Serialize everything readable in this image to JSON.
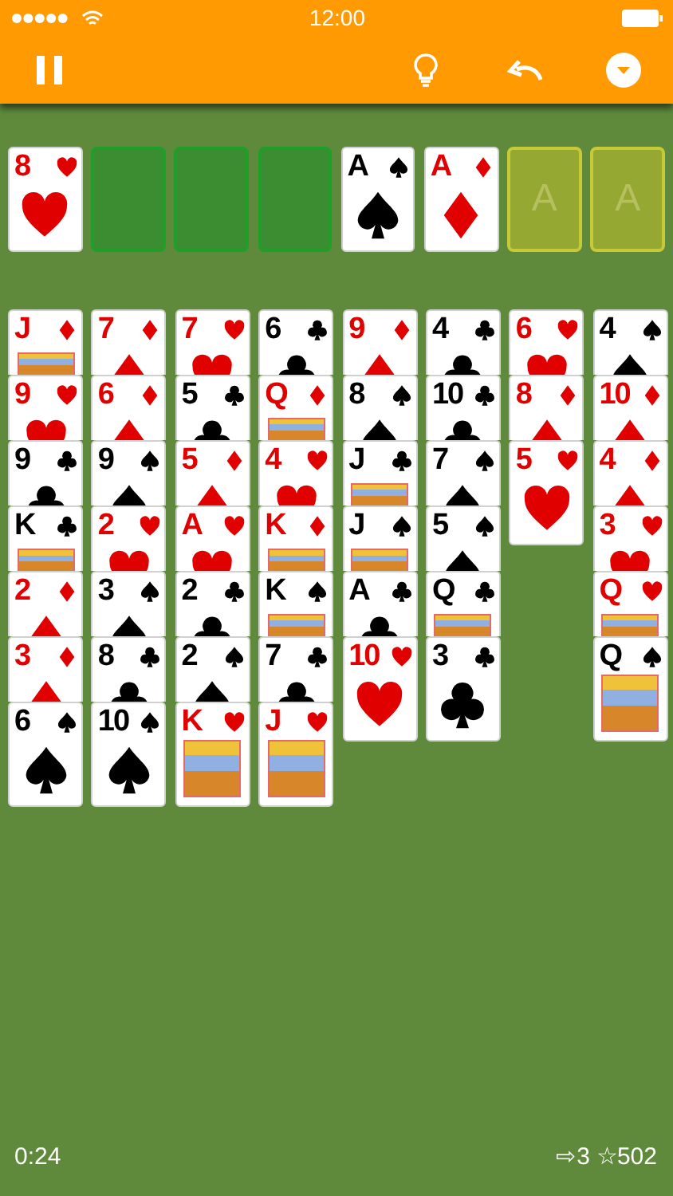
{
  "status_bar": {
    "time": "12:00"
  },
  "free_cells": [
    {
      "rank": "8",
      "kind": "heart",
      "court": false
    },
    {
      "kind": "empty"
    },
    {
      "kind": "empty"
    },
    {
      "kind": "empty"
    }
  ],
  "foundations": [
    {
      "rank": "A",
      "kind": "spade",
      "court": false
    },
    {
      "rank": "A",
      "kind": "diamond",
      "court": false
    },
    {
      "kind": "empty",
      "placeholder": "A"
    },
    {
      "kind": "empty",
      "placeholder": "A"
    }
  ],
  "tableau": [
    [
      {
        "rank": "J",
        "kind": "diamond",
        "court": true
      },
      {
        "rank": "9",
        "kind": "heart",
        "court": false
      },
      {
        "rank": "9",
        "kind": "club",
        "court": false
      },
      {
        "rank": "K",
        "kind": "club",
        "court": true
      },
      {
        "rank": "2",
        "kind": "diamond",
        "court": false
      },
      {
        "rank": "3",
        "kind": "diamond",
        "court": false
      },
      {
        "rank": "6",
        "kind": "spade",
        "court": false
      }
    ],
    [
      {
        "rank": "7",
        "kind": "diamond",
        "court": false
      },
      {
        "rank": "6",
        "kind": "diamond",
        "court": false
      },
      {
        "rank": "9",
        "kind": "spade",
        "court": false
      },
      {
        "rank": "2",
        "kind": "heart",
        "court": false
      },
      {
        "rank": "3",
        "kind": "spade",
        "court": false
      },
      {
        "rank": "8",
        "kind": "club",
        "court": false
      },
      {
        "rank": "10",
        "kind": "spade",
        "court": false
      }
    ],
    [
      {
        "rank": "7",
        "kind": "heart",
        "court": false
      },
      {
        "rank": "5",
        "kind": "club",
        "court": false
      },
      {
        "rank": "5",
        "kind": "diamond",
        "court": false
      },
      {
        "rank": "A",
        "kind": "heart",
        "court": false
      },
      {
        "rank": "2",
        "kind": "club",
        "court": false
      },
      {
        "rank": "2",
        "kind": "spade",
        "court": false
      },
      {
        "rank": "K",
        "kind": "heart",
        "court": true
      }
    ],
    [
      {
        "rank": "6",
        "kind": "club",
        "court": false
      },
      {
        "rank": "Q",
        "kind": "diamond",
        "court": true
      },
      {
        "rank": "4",
        "kind": "heart",
        "court": false
      },
      {
        "rank": "K",
        "kind": "diamond",
        "court": true
      },
      {
        "rank": "K",
        "kind": "spade",
        "court": true
      },
      {
        "rank": "7",
        "kind": "club",
        "court": false
      },
      {
        "rank": "J",
        "kind": "heart",
        "court": true
      }
    ],
    [
      {
        "rank": "9",
        "kind": "diamond",
        "court": false
      },
      {
        "rank": "8",
        "kind": "spade",
        "court": false
      },
      {
        "rank": "J",
        "kind": "club",
        "court": true
      },
      {
        "rank": "J",
        "kind": "spade",
        "court": true
      },
      {
        "rank": "A",
        "kind": "club",
        "court": false
      },
      {
        "rank": "10",
        "kind": "heart",
        "court": false
      }
    ],
    [
      {
        "rank": "4",
        "kind": "club",
        "court": false
      },
      {
        "rank": "10",
        "kind": "club",
        "court": false
      },
      {
        "rank": "7",
        "kind": "spade",
        "court": false
      },
      {
        "rank": "5",
        "kind": "spade",
        "court": false
      },
      {
        "rank": "Q",
        "kind": "club",
        "court": true
      },
      {
        "rank": "3",
        "kind": "club",
        "court": false
      }
    ],
    [
      {
        "rank": "6",
        "kind": "heart",
        "court": false
      },
      {
        "rank": "8",
        "kind": "diamond",
        "court": false
      },
      {
        "rank": "5",
        "kind": "heart",
        "court": false
      }
    ],
    [
      {
        "rank": "4",
        "kind": "spade",
        "court": false
      },
      {
        "rank": "10",
        "kind": "diamond",
        "court": false
      },
      {
        "rank": "4",
        "kind": "diamond",
        "court": false
      },
      {
        "rank": "3",
        "kind": "heart",
        "court": false
      },
      {
        "rank": "Q",
        "kind": "heart",
        "court": true
      },
      {
        "rank": "Q",
        "kind": "spade",
        "court": true
      }
    ]
  ],
  "footer": {
    "time": "0:24",
    "moves": "⇨3",
    "score": "☆502"
  }
}
